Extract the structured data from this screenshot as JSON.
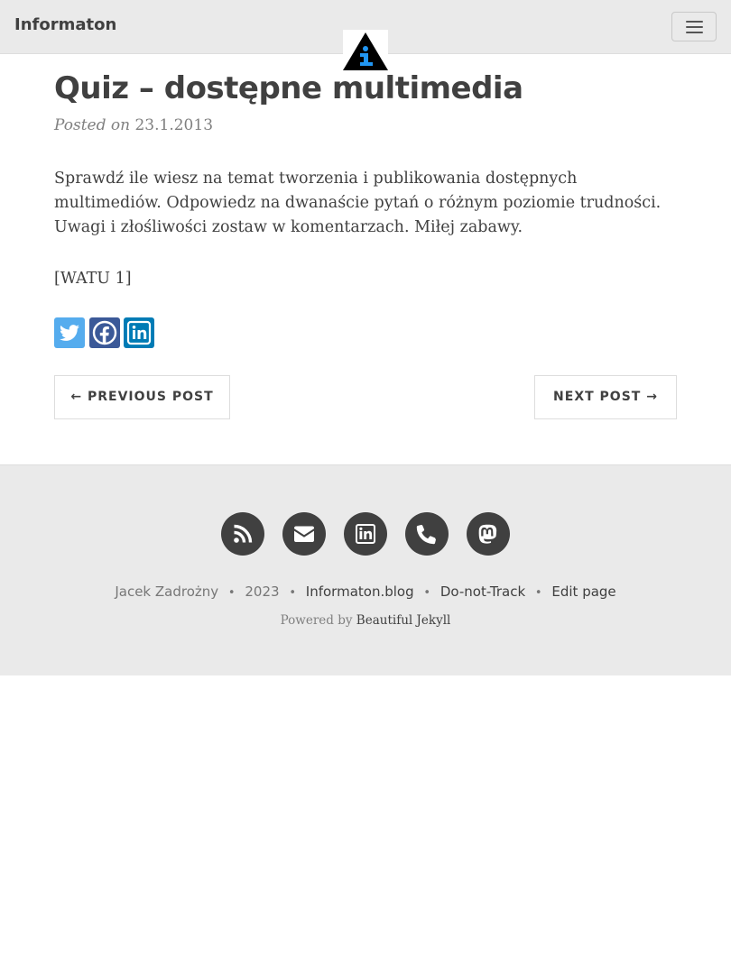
{
  "navbar": {
    "brand": "Informaton",
    "menu_icon": "hamburger-menu-icon",
    "avatar_icon": "information-triangle-logo"
  },
  "post": {
    "title": "Quiz – dostępne multimedia",
    "posted_prefix": "Posted on",
    "date": "23.1.2013",
    "paragraphs": [
      "Sprawdź ile wiesz na temat tworzenia i publikowania dostępnych multimediów. Odpowiedz na dwanaście pytań o różnym poziomie trudności. Uwagi i złośliwości zostaw w komentarzach. Miłej zabawy.",
      "[WATU 1]"
    ]
  },
  "share": [
    {
      "network": "twitter",
      "icon": "twitter-bird-icon",
      "color": "#55acee"
    },
    {
      "network": "facebook",
      "icon": "facebook-f-icon",
      "color": "#3b5998"
    },
    {
      "network": "linkedin",
      "icon": "linkedin-in-icon",
      "color": "#007bb5"
    }
  ],
  "pager": {
    "previous_label": "← PREVIOUS POST",
    "next_label": "NEXT POST →"
  },
  "footer": {
    "social": [
      {
        "name": "rss",
        "icon": "rss-icon"
      },
      {
        "name": "email",
        "icon": "envelope-icon"
      },
      {
        "name": "linkedin",
        "icon": "linkedin-in-icon"
      },
      {
        "name": "phone",
        "icon": "phone-icon"
      },
      {
        "name": "mastodon",
        "icon": "mastodon-icon"
      }
    ],
    "author": "Jacek Zadrożny",
    "year": "2023",
    "site_link": "Informaton.blog",
    "dnt_link": "Do-not-Track",
    "edit_link": "Edit page",
    "separator": "•",
    "powered_prefix": "Powered by",
    "powered_link": "Beautiful Jekyll"
  },
  "colors": {
    "text": "#404040",
    "navbar_bg": "#eaeaea",
    "footer_bg": "#eaeaea",
    "social_bg": "#404040",
    "logo_blue": "#2196f3"
  }
}
